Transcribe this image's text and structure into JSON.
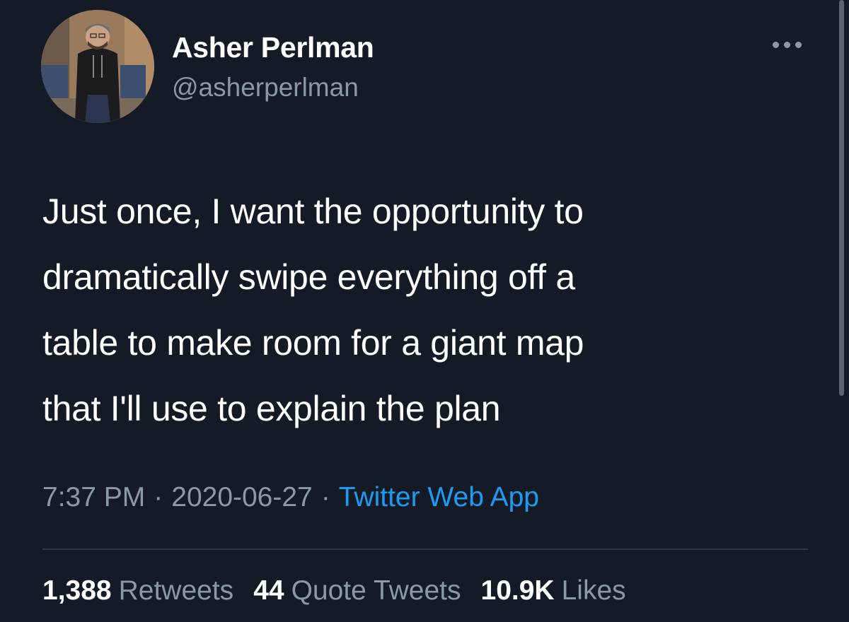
{
  "user": {
    "name": "Asher Perlman",
    "handle": "@asherperlman"
  },
  "tweet": {
    "lines": [
      "Just once, I want the opportunity to",
      "dramatically swipe everything off a",
      "table to make room for a giant map",
      "that I'll use to explain the plan"
    ],
    "time": "7:37 PM",
    "date": "2020-06-27",
    "separator": "·",
    "source": "Twitter Web App"
  },
  "stats": {
    "retweets_count": "1,388",
    "retweets_label": "Retweets",
    "quotes_count": "44",
    "quotes_label": "Quote Tweets",
    "likes_count": "10.9K",
    "likes_label": "Likes"
  },
  "icons": {
    "more": "more-horizontal-icon",
    "avatar": "profile-photo"
  },
  "colors": {
    "background": "#151b26",
    "text": "#ffffff",
    "muted": "#8b98a5",
    "link": "#1d9bf0"
  }
}
